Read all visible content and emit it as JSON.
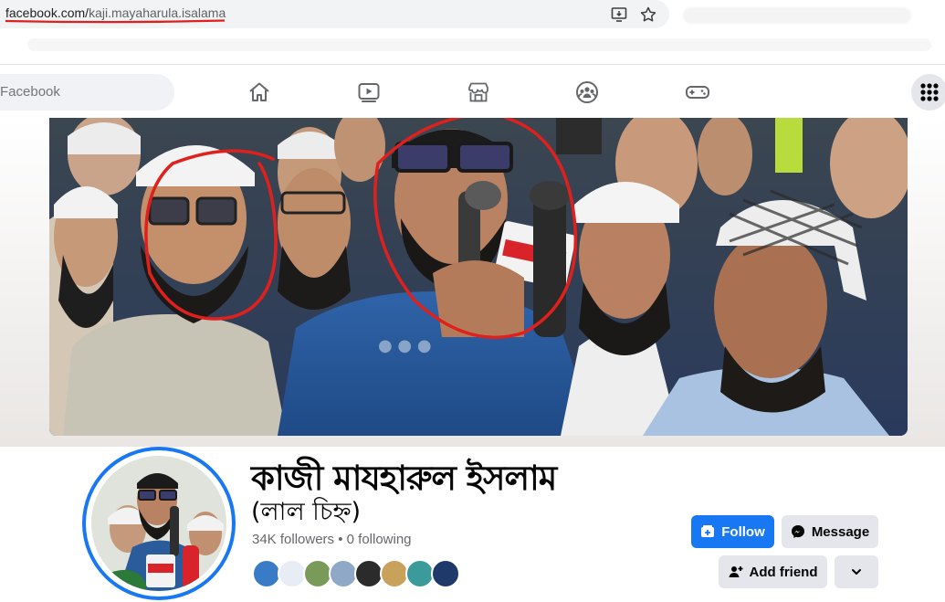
{
  "browser": {
    "url_domain": "facebook.com/",
    "url_path": "kaji.mayaharula.isalama",
    "icons": [
      "install-app-icon",
      "bookmark-star-icon"
    ]
  },
  "fb_nav": {
    "search_placeholder": "Facebook",
    "tabs": [
      "home-icon",
      "video-icon",
      "marketplace-icon",
      "groups-icon",
      "gaming-icon"
    ],
    "menu_icon": "grid-menu-icon"
  },
  "profile": {
    "name": "কাজী মাযহারুল ইসলাম",
    "subtitle": "(লাল চিহ্ন)",
    "followers": "34K followers",
    "separator": " • ",
    "following": "0 following",
    "mutual_avatars": 8
  },
  "actions": {
    "follow_label": "Follow",
    "message_label": "Message",
    "add_friend_label": "Add friend"
  },
  "colors": {
    "accent": "#1877f2",
    "annotation_red": "#e0201c",
    "secondary_button": "#e4e6eb",
    "muted_text": "#65676b"
  }
}
